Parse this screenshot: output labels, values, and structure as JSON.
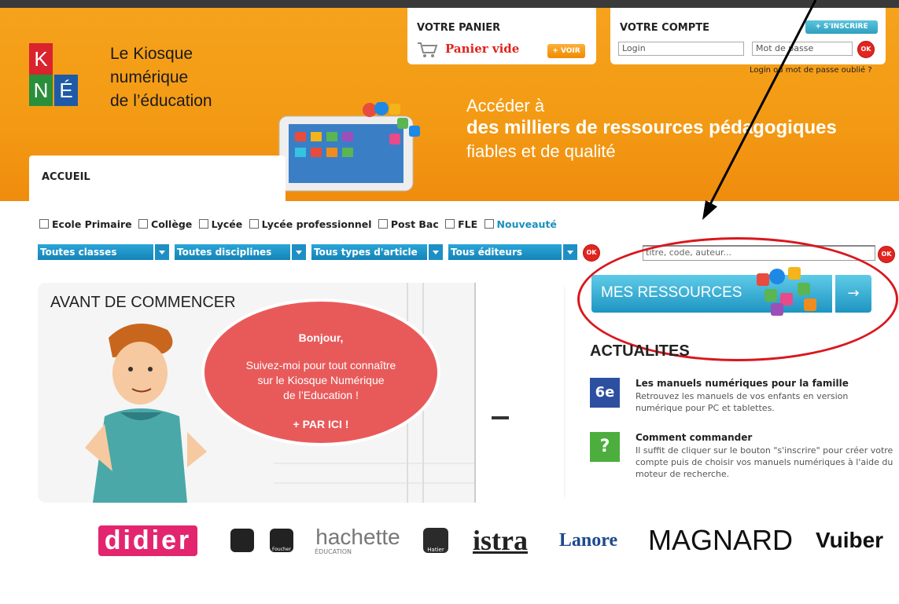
{
  "logo": {
    "letters": [
      "K",
      "N",
      "É"
    ],
    "line1": "Le Kiosque",
    "line2": "numérique",
    "line3": "de l’éducation"
  },
  "cart": {
    "title": "VOTRE PANIER",
    "status": "Panier vide",
    "view_button": "+ VOIR"
  },
  "account": {
    "title": "VOTRE COMPTE",
    "register_button": "+ S'INSCRIRE",
    "login_placeholder": "Login",
    "password_placeholder": "Mot de passe",
    "ok_label": "OK",
    "forgot": "Login ou mot de passe oublié ?"
  },
  "slogan": {
    "line1": "Accéder à",
    "line2": "des milliers de ressources pédagogiques",
    "line3": "fiables et de qualité"
  },
  "nav": {
    "home_tab": "ACCUEIL"
  },
  "filters": {
    "levels": [
      "Ecole Primaire",
      "Collège",
      "Lycée",
      "Lycée professionnel",
      "Post Bac",
      "FLE",
      "Nouveauté"
    ]
  },
  "dropdowns": {
    "classes": "Toutes classes",
    "disciplines": "Toutes disciplines",
    "types": "Tous types d'article",
    "editors": "Tous éditeurs"
  },
  "search": {
    "placeholder": "titre, code, auteur..."
  },
  "promo": {
    "title": "AVANT DE COMMENCER",
    "greeting": "Bonjour,",
    "line1": "Suivez-moi pour tout connaître",
    "line2": "sur le Kiosque Numérique",
    "line3": "de l’Education !",
    "cta": "+ PAR ICI !"
  },
  "resources": {
    "label": "MES RESSOURCES",
    "arrow": "→"
  },
  "news": {
    "title": "ACTUALITES",
    "items": [
      {
        "icon_text": "6e",
        "title": "Les manuels numériques pour la famille",
        "desc": "Retrouvez les manuels de vos enfants en version numérique pour PC et tablettes.",
        "color": "#2c4fa0"
      },
      {
        "icon_text": "?",
        "title": "Comment commander",
        "desc": "Il suffit de cliquer sur le bouton \"s'inscrire\" pour créer votre compte puis de choisir vos manuels numériques à l'aide du moteur de recherche.",
        "color": "#4cae3d"
      }
    ]
  },
  "publishers": [
    "didier",
    "Foucher",
    "hachette",
    "ÉDUCATION",
    "Hatier",
    "istra",
    "Lanore",
    "MAGNARD",
    "Vuiber"
  ]
}
